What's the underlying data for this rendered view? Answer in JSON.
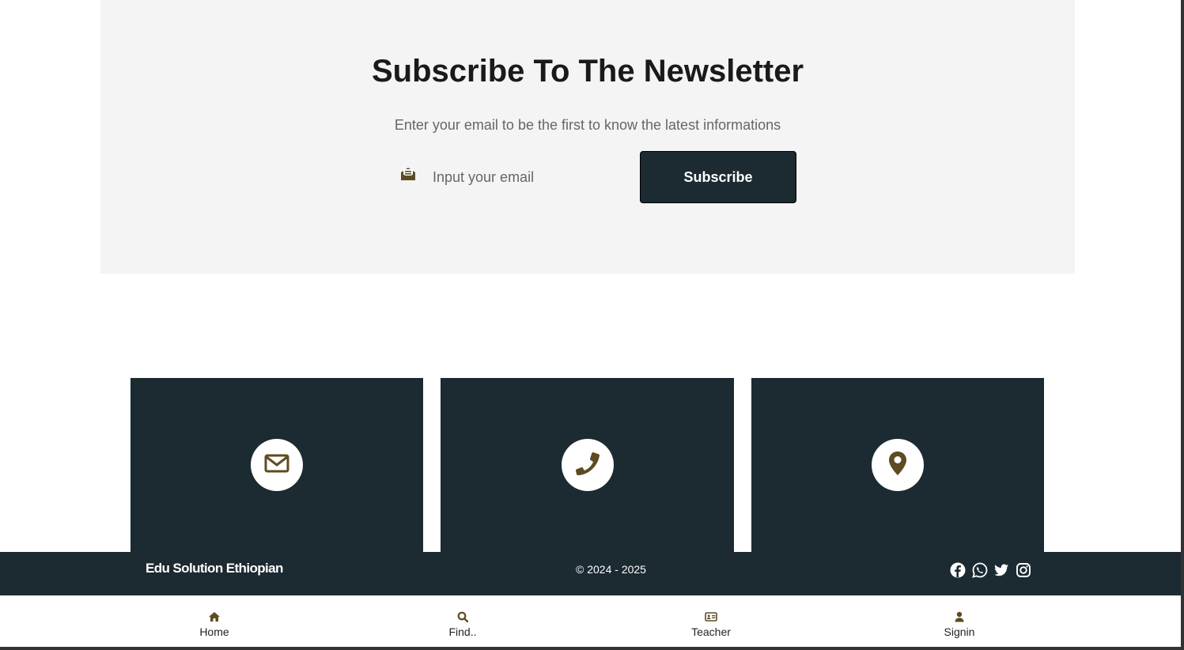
{
  "newsletter": {
    "title": "Subscribe To The Newsletter",
    "subtitle": "Enter your email to be the first to know the latest informations",
    "email_placeholder": "Input your email",
    "subscribe_label": "Subscribe",
    "input_icon": "envelope-open-icon"
  },
  "contact_cards": [
    {
      "icon": "envelope-icon"
    },
    {
      "icon": "phone-icon"
    },
    {
      "icon": "map-marker-icon"
    }
  ],
  "footer": {
    "brand": "Edu Solution Ethiopian",
    "copyright": "© 2024 - 2025",
    "social": [
      "facebook-icon",
      "whatsapp-icon",
      "twitter-icon",
      "instagram-icon"
    ]
  },
  "bottom_nav": [
    {
      "label": "Home",
      "icon": "home-icon"
    },
    {
      "label": "Find..",
      "icon": "search-icon"
    },
    {
      "label": "Teacher",
      "icon": "id-card-icon"
    },
    {
      "label": "Signin",
      "icon": "user-icon"
    }
  ],
  "colors": {
    "dark": "#1c2a31",
    "accent": "#5e4b22",
    "panel": "#f4f4f4"
  }
}
